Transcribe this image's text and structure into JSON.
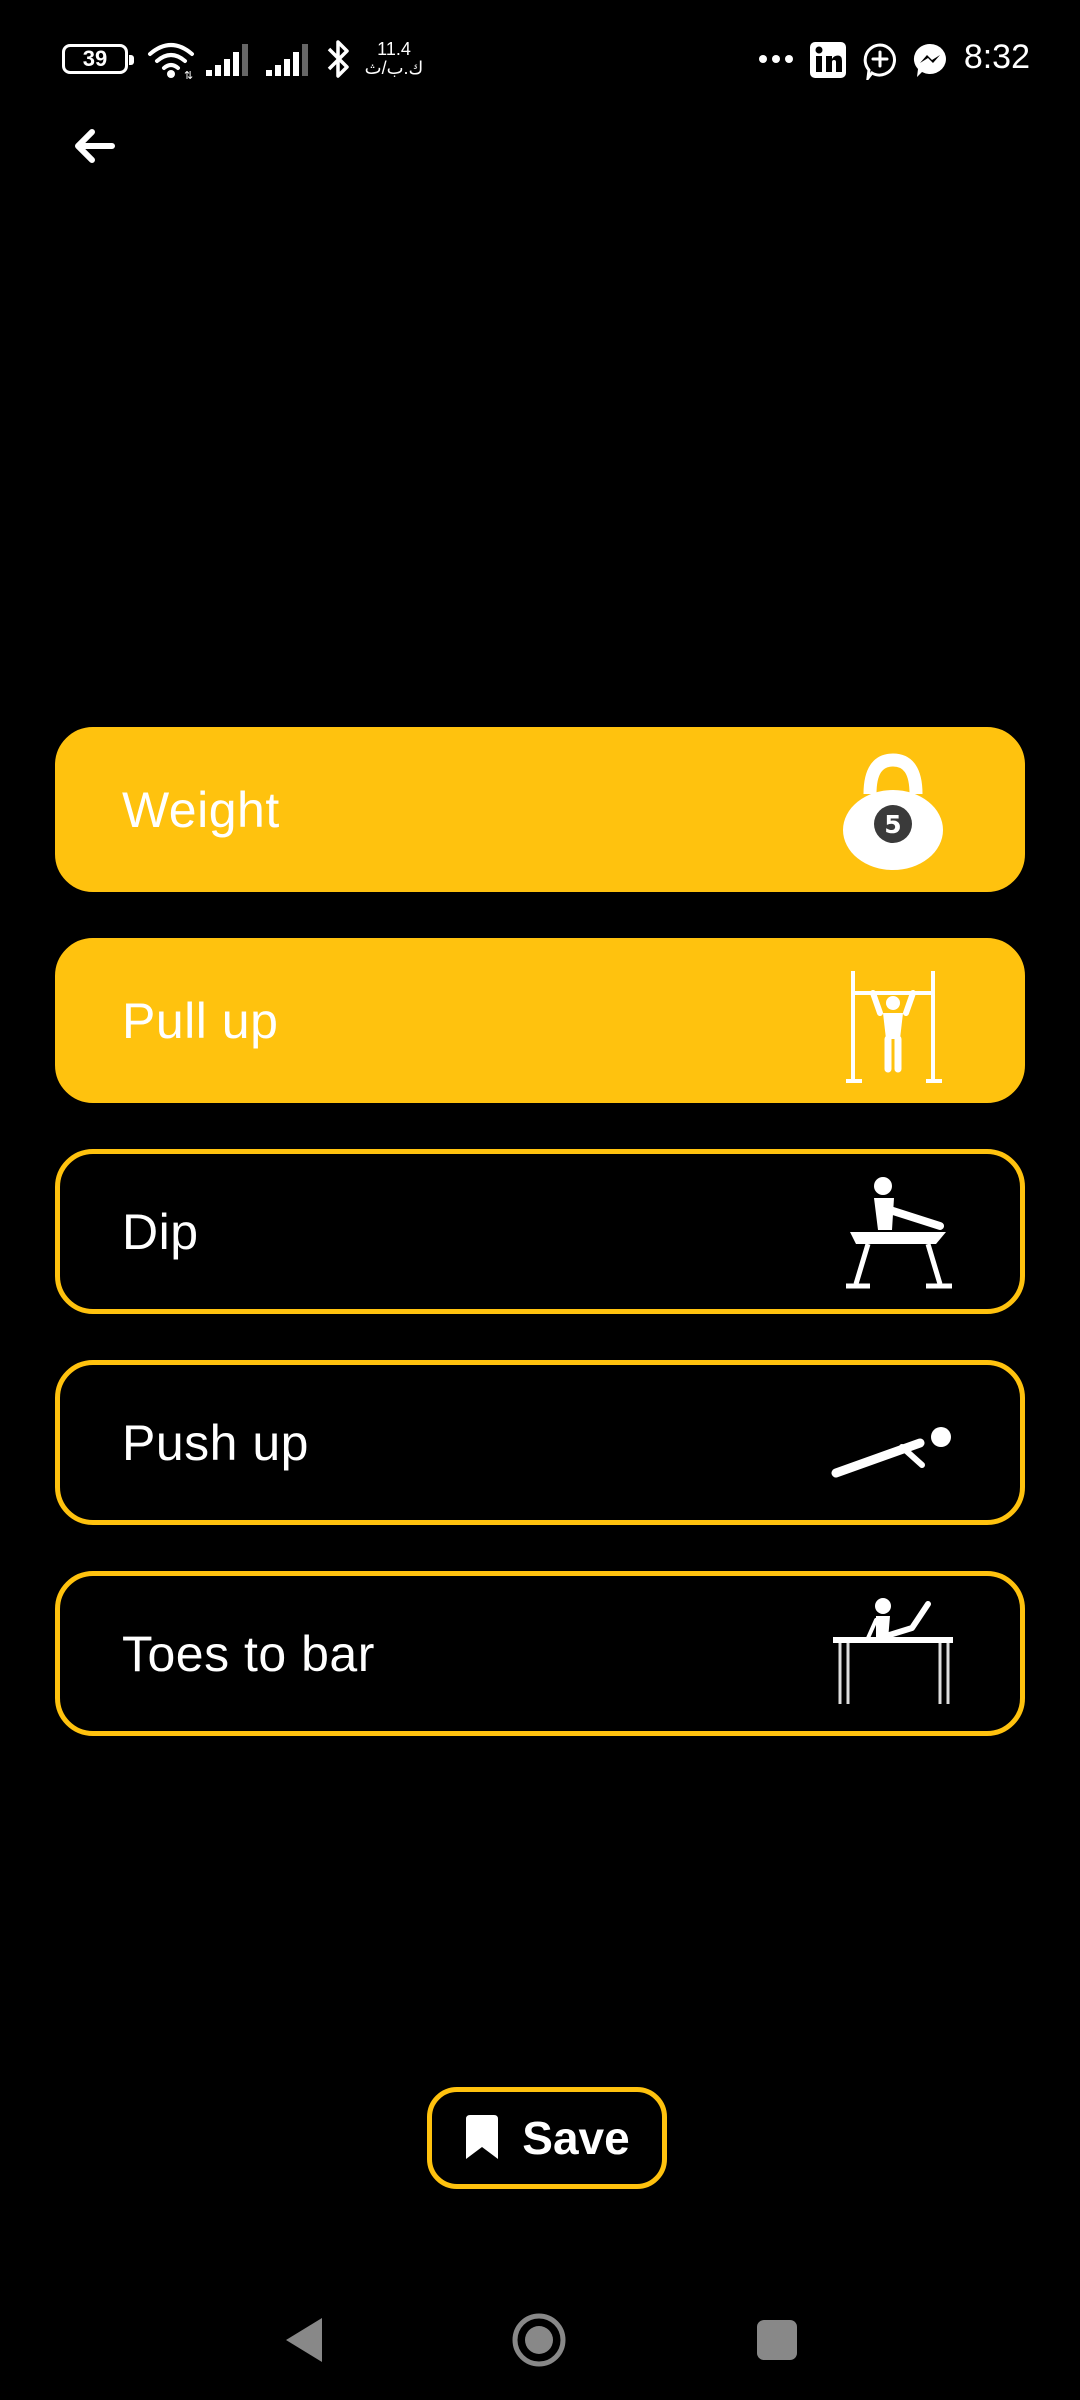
{
  "status_bar": {
    "battery": "39",
    "net_speed_value": "11.4",
    "net_speed_unit": "ك.ب/ث",
    "time": "8:32",
    "icons": [
      "wifi-icon",
      "signal-icon",
      "signal-icon",
      "bluetooth-icon",
      "more-icon",
      "linkedin-icon",
      "chat-add-icon",
      "messenger-icon"
    ]
  },
  "header": {
    "back_icon": "arrow-left-icon"
  },
  "exercises": [
    {
      "label": "Weight",
      "selected": true,
      "icon": "kettlebell-icon",
      "kettlebell_number": "5"
    },
    {
      "label": "Pull up",
      "selected": true,
      "icon": "pull-up-icon"
    },
    {
      "label": "Dip",
      "selected": false,
      "icon": "dip-icon"
    },
    {
      "label": "Push up",
      "selected": false,
      "icon": "push-up-icon"
    },
    {
      "label": "Toes to bar",
      "selected": false,
      "icon": "toes-to-bar-icon"
    }
  ],
  "save": {
    "label": "Save",
    "icon": "bookmark-icon"
  },
  "nav": {
    "icons": [
      "nav-back-icon",
      "nav-home-icon",
      "nav-recents-icon"
    ]
  },
  "colors": {
    "accent": "#ffc20e",
    "background": "#000000",
    "text": "#ffffff"
  }
}
